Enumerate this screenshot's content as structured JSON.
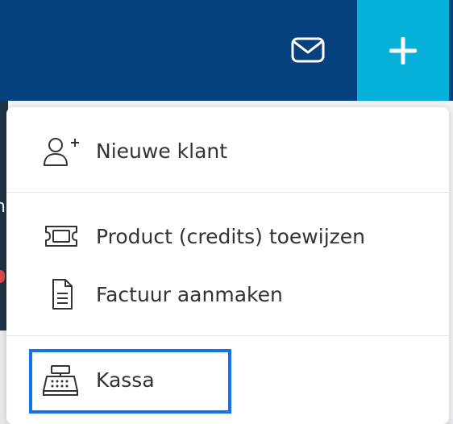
{
  "header": {
    "mail_icon": "mail-icon",
    "add_icon": "plus-icon",
    "colors": {
      "navy": "#05417f",
      "accent": "#06b1d9"
    }
  },
  "background": {
    "partial_char": "n"
  },
  "menu": {
    "items": [
      {
        "label": "Nieuwe klant",
        "icon": "add-user-icon"
      },
      {
        "label": "Product (credits) toewijzen",
        "icon": "ticket-icon"
      },
      {
        "label": "Factuur aanmaken",
        "icon": "document-icon"
      },
      {
        "label": "Kassa",
        "icon": "cash-register-icon"
      }
    ],
    "highlighted_item": "Kassa",
    "highlight_color": "#1173f0"
  }
}
